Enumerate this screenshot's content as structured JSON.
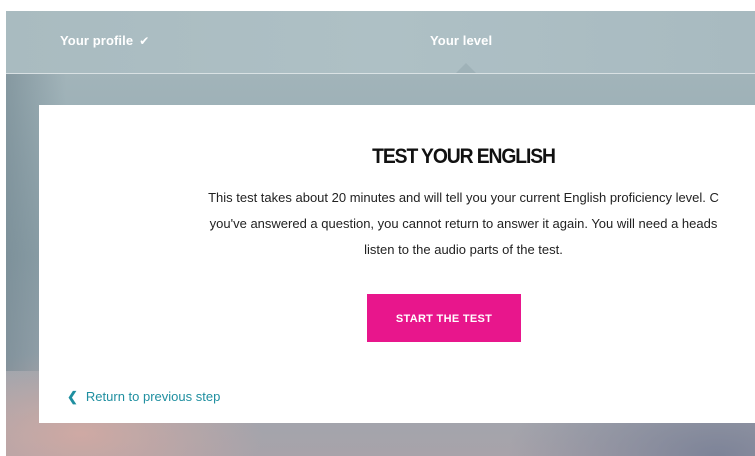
{
  "steps": [
    {
      "label": "Your profile",
      "status": "completed",
      "icon": "check-icon"
    },
    {
      "label": "Your level",
      "status": "active"
    }
  ],
  "card": {
    "title": "TEST YOUR ENGLISH",
    "description_lines": [
      "This test takes about 20 minutes and will tell you your current English proficiency level. C",
      "you've answered a question, you cannot return to answer it again. You will need a heads",
      "listen to the audio parts of the test."
    ],
    "start_button": "START THE TEST",
    "back_link": "Return to previous step"
  },
  "colors": {
    "accent_pink": "#e8168c",
    "link_teal": "#1f8fa0",
    "title_text": "#111111"
  }
}
